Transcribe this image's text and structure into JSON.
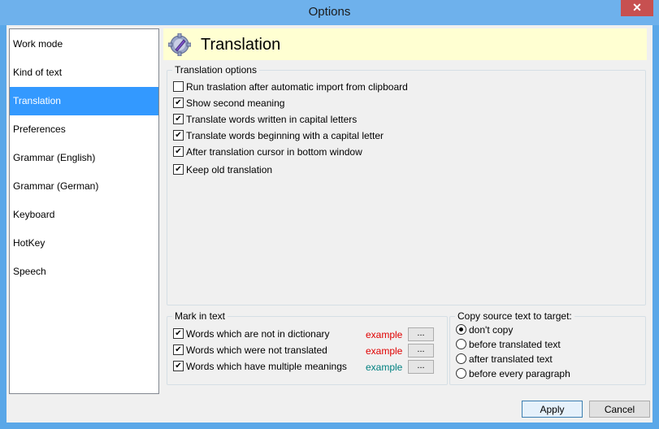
{
  "window": {
    "title": "Options",
    "close_glyph": "✕"
  },
  "sidebar": {
    "items": [
      {
        "label": "Work mode"
      },
      {
        "label": "Kind of text"
      },
      {
        "label": "Translation"
      },
      {
        "label": "Preferences"
      },
      {
        "label": "Grammar (English)"
      },
      {
        "label": "Grammar (German)"
      },
      {
        "label": "Keyboard"
      },
      {
        "label": "HotKey"
      },
      {
        "label": "Speech"
      }
    ],
    "active_index": 2
  },
  "header": {
    "title": "Translation",
    "icon": "gear-pencil-icon"
  },
  "translation_options": {
    "label": "Translation options",
    "items": [
      {
        "label": "Run traslation after automatic import from clipboard",
        "checked": false
      },
      {
        "label": "Show second meaning",
        "checked": true
      },
      {
        "label": "Translate words written in capital letters",
        "checked": true
      },
      {
        "label": "Translate words beginning with a capital letter",
        "checked": true
      },
      {
        "label": "After translation cursor in bottom window",
        "checked": true
      },
      {
        "label": "Keep old translation",
        "checked": true
      }
    ]
  },
  "mark_in_text": {
    "label": "Mark in text",
    "items": [
      {
        "label": "Words which are not in dictionary",
        "checked": true,
        "example": "example",
        "example_color": "#e00000",
        "button": "..."
      },
      {
        "label": "Words which were not translated",
        "checked": true,
        "example": "example",
        "example_color": "#e00000",
        "button": "..."
      },
      {
        "label": "Words which have multiple meanings",
        "checked": true,
        "example": "example",
        "example_color": "#008080",
        "button": "..."
      }
    ]
  },
  "copy_source": {
    "label": "Copy source text to target:",
    "options": [
      {
        "label": "don't copy",
        "selected": true
      },
      {
        "label": "before translated text",
        "selected": false
      },
      {
        "label": "after translated text",
        "selected": false
      },
      {
        "label": "before every paragraph",
        "selected": false
      }
    ]
  },
  "buttons": {
    "apply": "Apply",
    "cancel": "Cancel"
  },
  "colors": {
    "titlebar": "#6eb1ec",
    "selection": "#3399ff",
    "header_bg": "#ffffd2"
  }
}
